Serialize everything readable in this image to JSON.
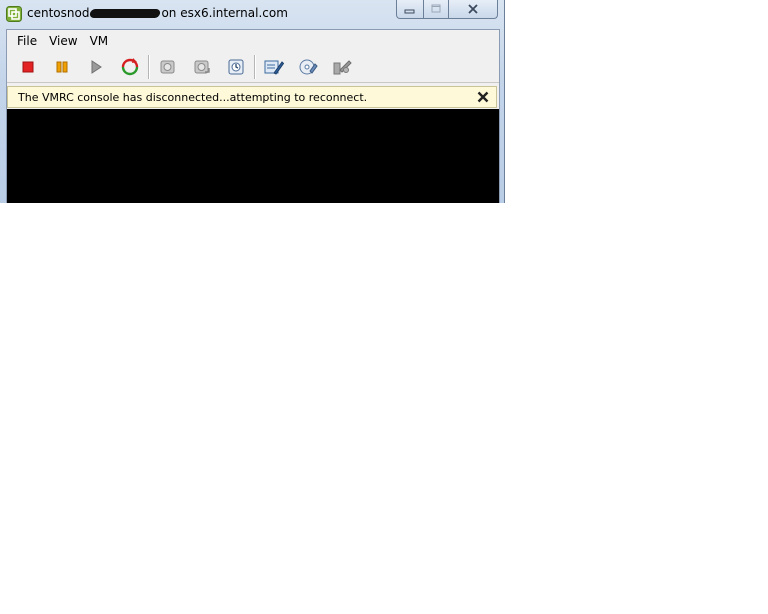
{
  "window": {
    "title_prefix": "centosnod",
    "title_suffix": "on esx6.internal.com"
  },
  "menu": {
    "items": [
      "File",
      "View",
      "VM"
    ]
  },
  "toolbar": {
    "buttons": [
      {
        "icon": "stop-icon"
      },
      {
        "icon": "pause-icon"
      },
      {
        "icon": "play-icon"
      },
      {
        "icon": "reset-icon"
      },
      {
        "icon": "snapshot-icon"
      },
      {
        "icon": "revert-snapshot-icon"
      },
      {
        "icon": "snapshot-manager-icon"
      },
      {
        "icon": "edit-settings-icon"
      },
      {
        "icon": "cd-dvd-icon"
      },
      {
        "icon": "tools-icon"
      }
    ]
  },
  "banner": {
    "message": "The VMRC console has disconnected...attempting to reconnect."
  },
  "colors": {
    "banner_bg": "#fdf9d9",
    "console_bg": "#000000",
    "stop_red": "#e32323",
    "pause_orange": "#f0a000"
  }
}
